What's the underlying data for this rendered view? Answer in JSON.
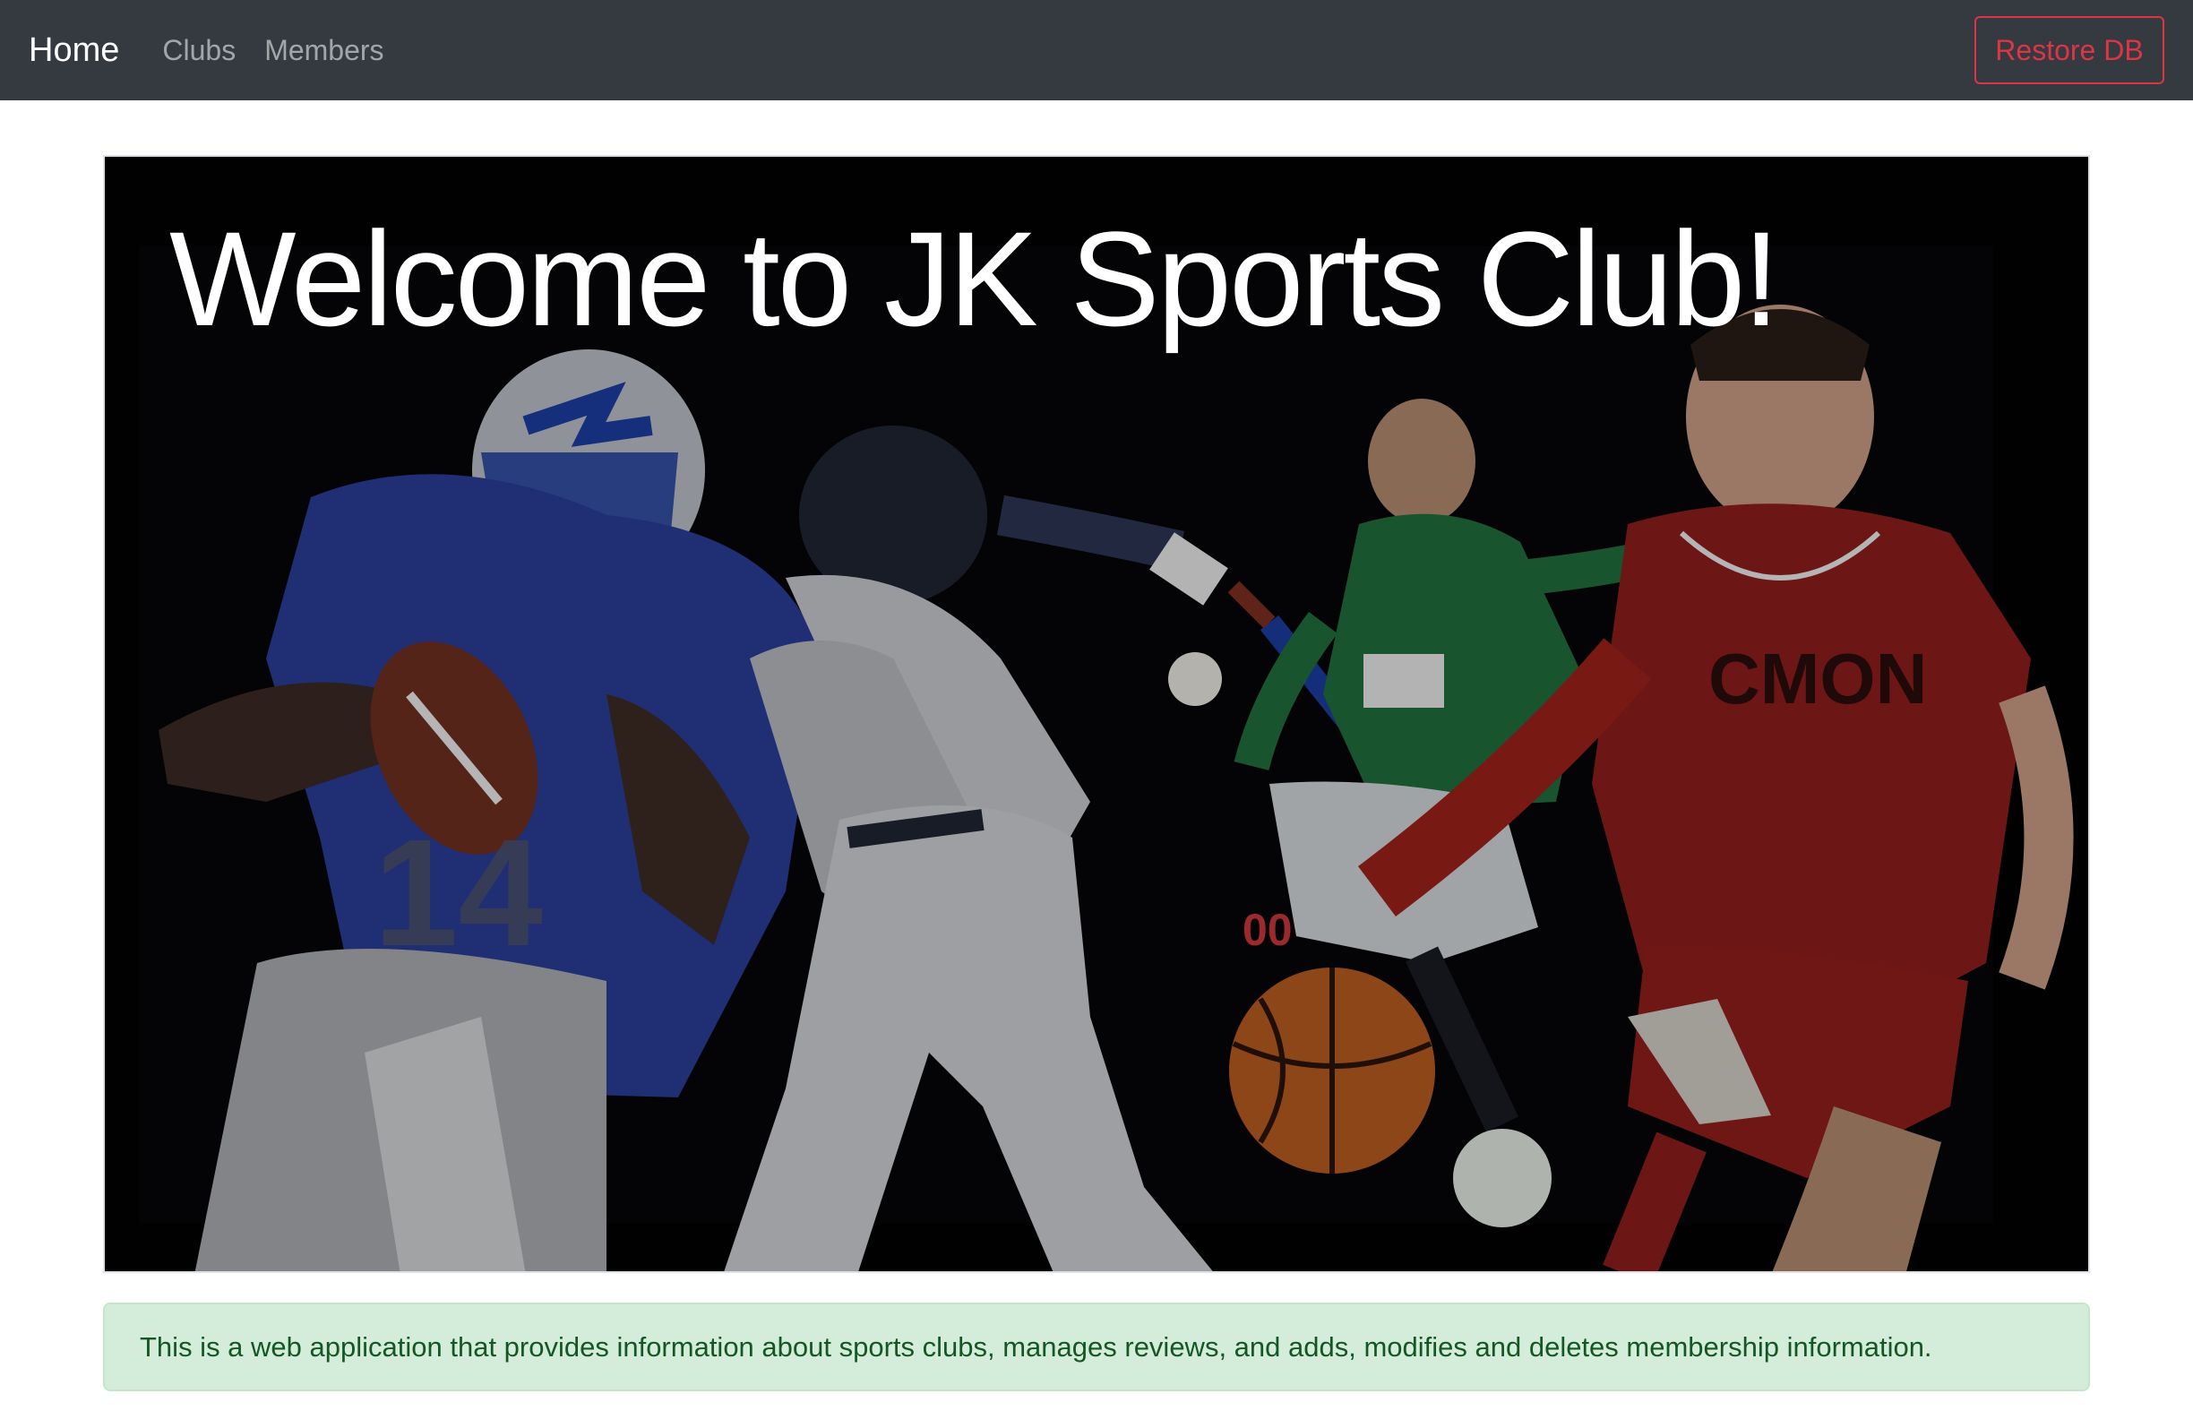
{
  "navbar": {
    "brand": "Home",
    "links": [
      "Clubs",
      "Members"
    ],
    "restore_label": "Restore DB",
    "colors": {
      "background": "#343a40",
      "danger": "#dc3545"
    }
  },
  "hero": {
    "title": "Welcome to JK Sports Club!",
    "image_subject": "athletes-collage"
  },
  "alert": {
    "text": "This is a web application that provides information about sports clubs, manages reviews, and adds, modifies and deletes membership information.",
    "colors": {
      "background": "#d4edda",
      "text": "#155724"
    }
  }
}
